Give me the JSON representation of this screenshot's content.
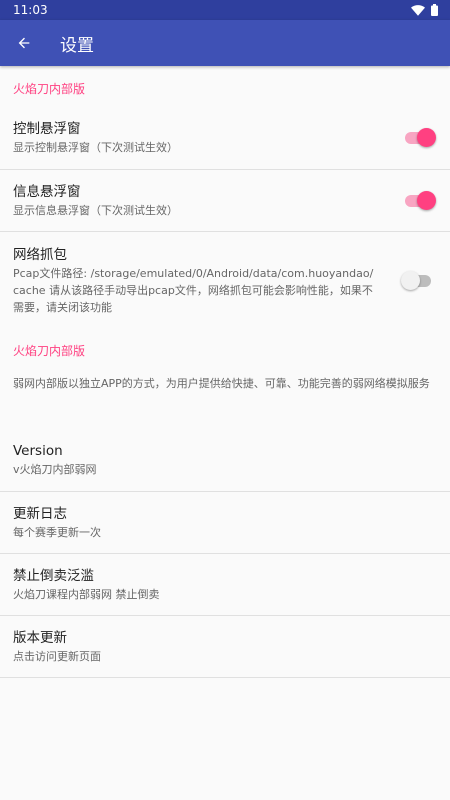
{
  "status": {
    "time": "11:03",
    "wifi_icon": "wifi-icon",
    "battery_icon": "battery-icon"
  },
  "appbar": {
    "title": "设置",
    "back_icon": "arrow-back-icon"
  },
  "colors": {
    "primary": "#3f51b5",
    "primary_dark": "#2f3f9e",
    "accent": "#ff4081"
  },
  "categories": [
    {
      "title": "火焰刀内部版",
      "prefs": [
        {
          "title": "控制悬浮窗",
          "summary": "显示控制悬浮窗（下次测试生效）",
          "switch_on": true
        },
        {
          "title": "信息悬浮窗",
          "summary": "显示信息悬浮窗（下次测试生效）",
          "switch_on": true
        },
        {
          "title": "网络抓包",
          "summary": "Pcap文件路径: /storage/emulated/0/Android/data/com.huoyandao/cache 请从该路径手动导出pcap文件，网络抓包可能会影响性能，如果不需要，请关闭该功能",
          "switch_on": false
        }
      ]
    },
    {
      "title": "火焰刀内部版",
      "description": "弱网内部版以独立APP的方式，为用户提供给快捷、可靠、功能完善的弱网络模拟服务",
      "prefs": [
        {
          "title": "Version",
          "summary": "v火焰刀内部弱网"
        },
        {
          "title": "更新日志",
          "summary": "每个赛季更新一次"
        },
        {
          "title": "禁止倒卖泛滥",
          "summary": "火焰刀课程内部弱网 禁止倒卖"
        },
        {
          "title": "版本更新",
          "summary": "点击访问更新页面"
        }
      ]
    }
  ]
}
